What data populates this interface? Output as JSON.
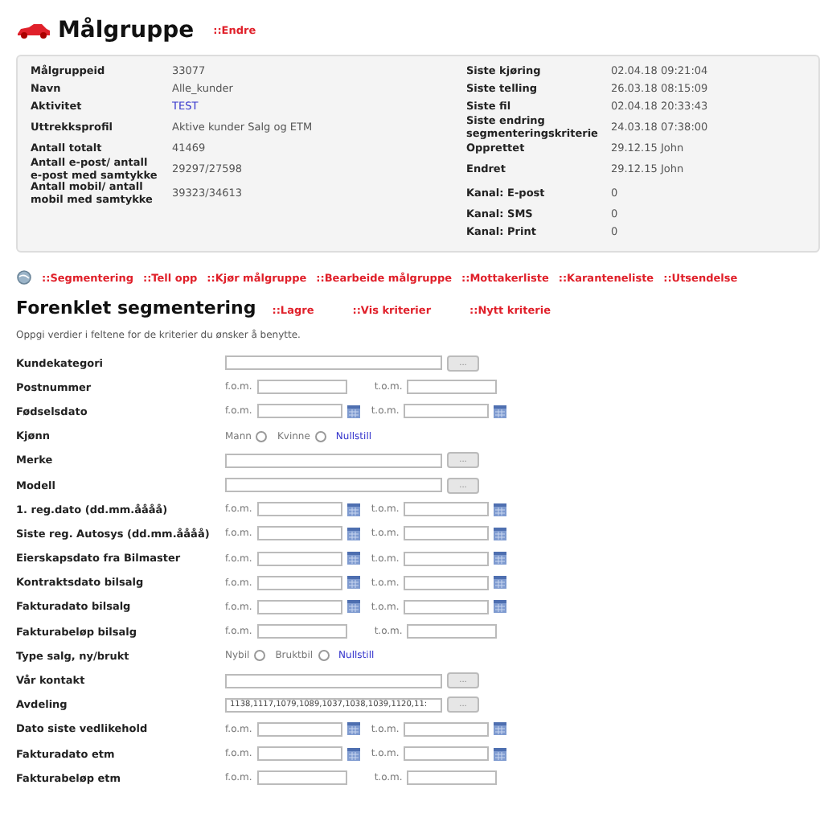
{
  "header": {
    "title": "Målgruppe",
    "action": "::Endre"
  },
  "info": [
    {
      "label": "Målgruppeid",
      "value": "33077",
      "label2": "Siste kjøring",
      "value2": "02.04.18 09:21:04"
    },
    {
      "label": "Navn",
      "value": "Alle_kunder",
      "label2": "Siste telling",
      "value2": "26.03.18 08:15:09"
    },
    {
      "label": "Aktivitet",
      "value": "TEST",
      "link": true,
      "label2": "Siste fil",
      "value2": "02.04.18 20:33:43"
    },
    {
      "label": "Uttrekksprofil",
      "value": "Aktive kunder Salg og ETM",
      "label2": "Siste endring segmenteringskriterie",
      "value2": "24.03.18 07:38:00"
    },
    {
      "label": "Antall totalt",
      "value": "41469",
      "label2": "Opprettet",
      "value2": "29.12.15 John"
    },
    {
      "label": "Antall e-post/ antall e-post med samtykke",
      "value": "29297/27598",
      "label2": "Endret",
      "value2": "29.12.15 John"
    },
    {
      "label": "Antall mobil/ antall mobil med samtykke",
      "value": "39323/34613",
      "label2": "Kanal: E-post",
      "value2": "0"
    },
    {
      "label2": "Kanal: SMS",
      "value2": "0"
    },
    {
      "label2": "Kanal: Print",
      "value2": "0"
    }
  ],
  "nav": [
    "::Segmentering",
    "::Tell opp",
    "::Kjør målgruppe",
    "::Bearbeide målgruppe",
    "::Mottakerliste",
    "::Karanteneliste",
    "::Utsendelse"
  ],
  "section": {
    "title": "Forenklet segmentering",
    "actions": [
      "::Lagre",
      "::Vis kriterier",
      "::Nytt kriterie"
    ]
  },
  "instruction": "Oppgi verdier i feltene for de kriterier du ønsker å benytte.",
  "rows": [
    {
      "label": "Kundekategori",
      "kind": "lookup",
      "button": "..."
    },
    {
      "label": "Postnummer",
      "kind": "range",
      "from": "f.o.m.",
      "to": "t.o.m."
    },
    {
      "label": "Fødselsdato",
      "kind": "daterange",
      "from": "f.o.m.",
      "to": "t.o.m."
    },
    {
      "label": "Kjønn",
      "kind": "radio",
      "options": [
        {
          "label": "Mann",
          "selected": false
        },
        {
          "label": "Kvinne",
          "selected": false
        }
      ],
      "reset": "Nullstill"
    },
    {
      "label": "Merke",
      "kind": "lookup",
      "button": "..."
    },
    {
      "label": "Modell",
      "kind": "lookup",
      "button": "..."
    },
    {
      "label": "1. reg.dato (dd.mm.åååå)",
      "kind": "daterange",
      "from": "f.o.m.",
      "to": "t.o.m."
    },
    {
      "label": "Siste reg. Autosys (dd.mm.åååå)",
      "kind": "daterange",
      "from": "f.o.m.",
      "to": "t.o.m."
    },
    {
      "label": "Eierskapsdato fra Bilmaster",
      "kind": "daterange",
      "from": "f.o.m.",
      "to": "t.o.m."
    },
    {
      "label": "Kontraktsdato bilsalg",
      "kind": "daterange",
      "from": "f.o.m.",
      "to": "t.o.m."
    },
    {
      "label": "Fakturadato bilsalg",
      "kind": "daterange",
      "from": "f.o.m.",
      "to": "t.o.m."
    },
    {
      "label": "Fakturabeløp bilsalg",
      "kind": "range",
      "from": "f.o.m.",
      "to": "t.o.m."
    },
    {
      "label": "Type salg, ny/brukt",
      "kind": "radio",
      "options": [
        {
          "label": "Nybil",
          "selected": false
        },
        {
          "label": "Bruktbil",
          "selected": false
        }
      ],
      "reset": "Nullstill"
    },
    {
      "label": "Vår kontakt",
      "kind": "lookup",
      "button": "..."
    },
    {
      "label": "Avdeling",
      "kind": "lookup",
      "value": "1138,1117,1079,1089,1037,1038,1039,1120,11:",
      "button": "..."
    },
    {
      "label": "Dato siste vedlikehold",
      "kind": "daterange",
      "from": "f.o.m.",
      "to": "t.o.m."
    },
    {
      "label": "Fakturadato etm",
      "kind": "daterange",
      "from": "f.o.m.",
      "to": "t.o.m."
    },
    {
      "label": "Fakturabeløp etm",
      "kind": "range",
      "from": "f.o.m.",
      "to": "t.o.m."
    }
  ]
}
